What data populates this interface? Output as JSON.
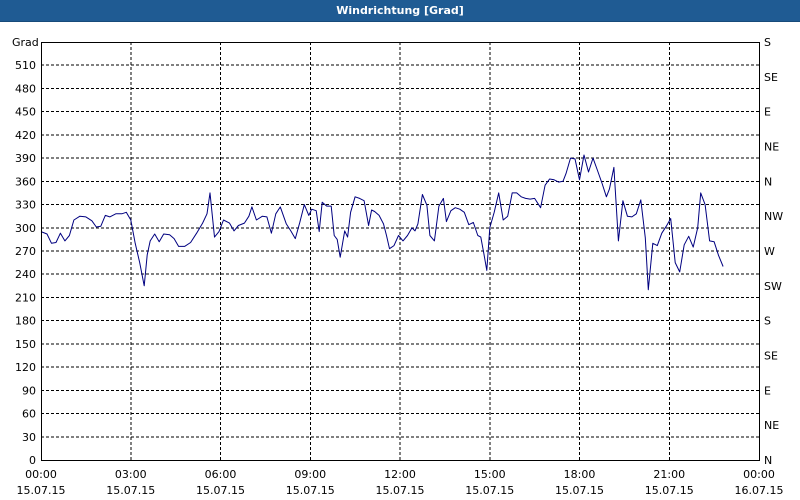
{
  "window": {
    "title": "Windrichtung [Grad]"
  },
  "chart_data": {
    "type": "line",
    "title": "Windrichtung [Grad]",
    "ylabel": "Grad",
    "ylim": [
      0,
      540
    ],
    "yticks": [
      0,
      30,
      60,
      90,
      120,
      150,
      180,
      210,
      240,
      270,
      300,
      330,
      360,
      390,
      420,
      450,
      480,
      510
    ],
    "y2ticks": [
      {
        "value": 0,
        "label": "N"
      },
      {
        "value": 45,
        "label": "NE"
      },
      {
        "value": 90,
        "label": "E"
      },
      {
        "value": 135,
        "label": "SE"
      },
      {
        "value": 180,
        "label": "S"
      },
      {
        "value": 225,
        "label": "SW"
      },
      {
        "value": 270,
        "label": "W"
      },
      {
        "value": 315,
        "label": "NW"
      },
      {
        "value": 360,
        "label": "N"
      },
      {
        "value": 405,
        "label": "NE"
      },
      {
        "value": 450,
        "label": "E"
      },
      {
        "value": 495,
        "label": "SE"
      },
      {
        "value": 540,
        "label": "S"
      }
    ],
    "xlim": [
      0,
      24
    ],
    "xticks": [
      {
        "x": 0,
        "time": "00:00",
        "date": "15.07.15"
      },
      {
        "x": 3,
        "time": "03:00",
        "date": "15.07.15"
      },
      {
        "x": 6,
        "time": "06:00",
        "date": "15.07.15"
      },
      {
        "x": 9,
        "time": "09:00",
        "date": "15.07.15"
      },
      {
        "x": 12,
        "time": "12:00",
        "date": "15.07.15"
      },
      {
        "x": 15,
        "time": "15:00",
        "date": "15.07.15"
      },
      {
        "x": 18,
        "time": "18:00",
        "date": "15.07.15"
      },
      {
        "x": 21,
        "time": "21:00",
        "date": "15.07.15"
      },
      {
        "x": 24,
        "time": "00:00",
        "date": "16.07.15"
      }
    ],
    "grid": true,
    "series": [
      {
        "color": "#000080",
        "points": [
          [
            0.0,
            295
          ],
          [
            0.2,
            292
          ],
          [
            0.35,
            280
          ],
          [
            0.5,
            281
          ],
          [
            0.65,
            293
          ],
          [
            0.8,
            283
          ],
          [
            0.95,
            290
          ],
          [
            1.1,
            310
          ],
          [
            1.3,
            315
          ],
          [
            1.5,
            314
          ],
          [
            1.7,
            309
          ],
          [
            1.85,
            301
          ],
          [
            2.0,
            302
          ],
          [
            2.15,
            316
          ],
          [
            2.3,
            314
          ],
          [
            2.5,
            318
          ],
          [
            2.7,
            318
          ],
          [
            2.85,
            320
          ],
          [
            3.0,
            310
          ],
          [
            3.15,
            280
          ],
          [
            3.3,
            255
          ],
          [
            3.45,
            225
          ],
          [
            3.55,
            265
          ],
          [
            3.65,
            283
          ],
          [
            3.8,
            292
          ],
          [
            3.95,
            282
          ],
          [
            4.1,
            292
          ],
          [
            4.3,
            291
          ],
          [
            4.45,
            286
          ],
          [
            4.6,
            276
          ],
          [
            4.8,
            276
          ],
          [
            5.0,
            281
          ],
          [
            5.2,
            293
          ],
          [
            5.4,
            306
          ],
          [
            5.55,
            318
          ],
          [
            5.65,
            345
          ],
          [
            5.8,
            288
          ],
          [
            5.95,
            295
          ],
          [
            6.1,
            310
          ],
          [
            6.3,
            306
          ],
          [
            6.45,
            296
          ],
          [
            6.6,
            303
          ],
          [
            6.8,
            306
          ],
          [
            6.95,
            315
          ],
          [
            7.05,
            327
          ],
          [
            7.2,
            310
          ],
          [
            7.4,
            315
          ],
          [
            7.55,
            314
          ],
          [
            7.7,
            293
          ],
          [
            7.85,
            318
          ],
          [
            8.0,
            327
          ],
          [
            8.2,
            305
          ],
          [
            8.35,
            296
          ],
          [
            8.5,
            286
          ],
          [
            8.65,
            307
          ],
          [
            8.8,
            330
          ],
          [
            8.95,
            316
          ],
          [
            9.05,
            324
          ],
          [
            9.2,
            322
          ],
          [
            9.3,
            295
          ],
          [
            9.4,
            333
          ],
          [
            9.55,
            328
          ],
          [
            9.7,
            328
          ],
          [
            9.8,
            290
          ],
          [
            9.9,
            285
          ],
          [
            10.0,
            262
          ],
          [
            10.15,
            296
          ],
          [
            10.25,
            288
          ],
          [
            10.35,
            320
          ],
          [
            10.5,
            340
          ],
          [
            10.65,
            338
          ],
          [
            10.8,
            335
          ],
          [
            10.95,
            303
          ],
          [
            11.05,
            323
          ],
          [
            11.15,
            321
          ],
          [
            11.3,
            316
          ],
          [
            11.45,
            305
          ],
          [
            11.55,
            290
          ],
          [
            11.65,
            273
          ],
          [
            11.8,
            277
          ],
          [
            11.95,
            290
          ],
          [
            12.1,
            283
          ],
          [
            12.25,
            290
          ],
          [
            12.4,
            300
          ],
          [
            12.5,
            296
          ],
          [
            12.6,
            305
          ],
          [
            12.75,
            343
          ],
          [
            12.9,
            329
          ],
          [
            13.0,
            290
          ],
          [
            13.15,
            283
          ],
          [
            13.3,
            328
          ],
          [
            13.45,
            338
          ],
          [
            13.55,
            308
          ],
          [
            13.7,
            322
          ],
          [
            13.85,
            326
          ],
          [
            14.0,
            324
          ],
          [
            14.15,
            320
          ],
          [
            14.3,
            304
          ],
          [
            14.45,
            307
          ],
          [
            14.6,
            290
          ],
          [
            14.7,
            288
          ],
          [
            14.8,
            267
          ],
          [
            14.9,
            245
          ],
          [
            15.0,
            300
          ],
          [
            15.15,
            320
          ],
          [
            15.3,
            345
          ],
          [
            15.45,
            310
          ],
          [
            15.6,
            315
          ],
          [
            15.75,
            345
          ],
          [
            15.9,
            345
          ],
          [
            16.05,
            340
          ],
          [
            16.2,
            338
          ],
          [
            16.35,
            337
          ],
          [
            16.5,
            338
          ],
          [
            16.7,
            326
          ],
          [
            16.85,
            355
          ],
          [
            17.0,
            363
          ],
          [
            17.15,
            362
          ],
          [
            17.3,
            359
          ],
          [
            17.45,
            360
          ],
          [
            17.55,
            370
          ],
          [
            17.7,
            390
          ],
          [
            17.85,
            389
          ],
          [
            18.0,
            362
          ],
          [
            18.15,
            394
          ],
          [
            18.3,
            372
          ],
          [
            18.45,
            390
          ],
          [
            18.6,
            374
          ],
          [
            18.75,
            358
          ],
          [
            18.9,
            340
          ],
          [
            19.0,
            350
          ],
          [
            19.15,
            378
          ],
          [
            19.3,
            283
          ],
          [
            19.45,
            335
          ],
          [
            19.6,
            315
          ],
          [
            19.75,
            314
          ],
          [
            19.9,
            318
          ],
          [
            20.05,
            336
          ],
          [
            20.2,
            287
          ],
          [
            20.3,
            220
          ],
          [
            20.45,
            280
          ],
          [
            20.6,
            277
          ],
          [
            20.75,
            293
          ],
          [
            20.9,
            302
          ],
          [
            21.05,
            312
          ],
          [
            21.2,
            255
          ],
          [
            21.35,
            243
          ],
          [
            21.5,
            278
          ],
          [
            21.65,
            289
          ],
          [
            21.8,
            275
          ],
          [
            21.95,
            300
          ],
          [
            22.05,
            345
          ],
          [
            22.2,
            330
          ],
          [
            22.35,
            283
          ],
          [
            22.5,
            282
          ],
          [
            22.65,
            264
          ],
          [
            22.8,
            250
          ]
        ]
      }
    ]
  }
}
